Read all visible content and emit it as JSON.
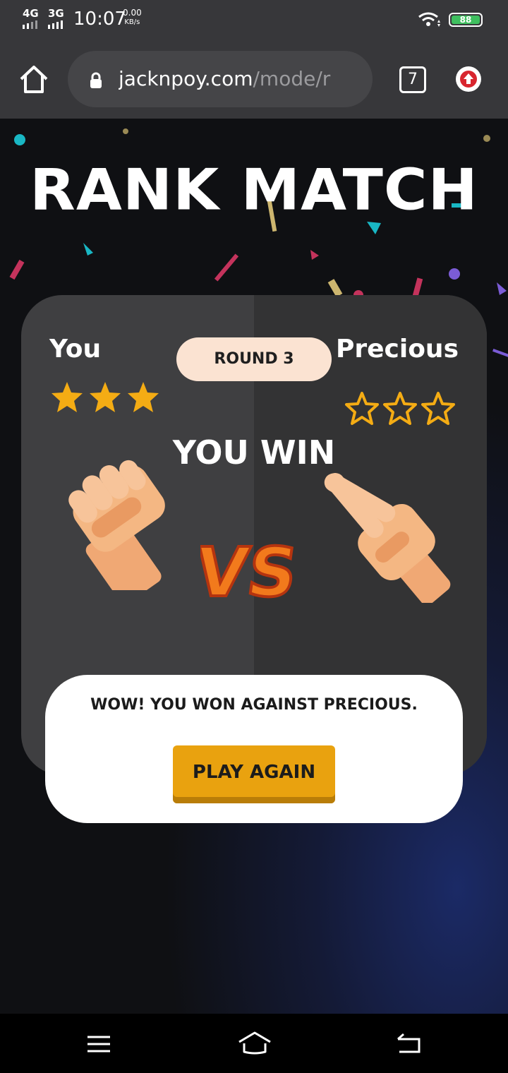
{
  "status_bar": {
    "network_1": "4G",
    "network_2": "3G",
    "time": "10:07",
    "speed_value": "0.00",
    "speed_unit": "KB/s",
    "battery": "88"
  },
  "browser": {
    "url_host": "jacknpoy.com",
    "url_path": "/mode/r",
    "tab_count": "7",
    "icons": [
      "home-icon",
      "lock-icon",
      "tabs-icon",
      "upload-icon"
    ]
  },
  "game": {
    "title": "RANK MATCH",
    "player_name": "You",
    "opponent_name": "Precious",
    "round_label": "ROUND 3",
    "player_stars": 3,
    "opponent_stars": 0,
    "max_stars": 3,
    "result_text": "YOU WIN",
    "player_hand": "rock",
    "opponent_hand": "scissors",
    "vs_label": "VS",
    "message": "WOW! YOU WON AGAINST PRECIOUS.",
    "play_again_label": "PLAY AGAIN",
    "accent_color": "#e9a20f",
    "star_color": "#f4ac14"
  },
  "nav_bar": {
    "icons": [
      "menu-icon",
      "home-icon",
      "back-icon"
    ]
  }
}
